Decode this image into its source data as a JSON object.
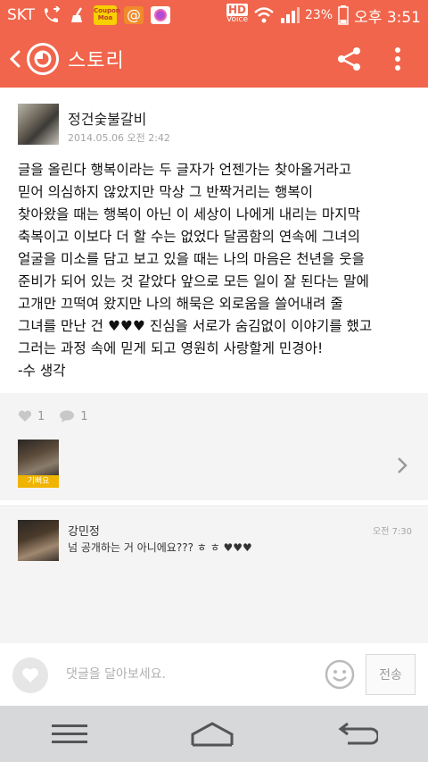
{
  "status_bar": {
    "carrier": "SKT",
    "coupon_line1": "Coupon",
    "coupon_line2": "Moa",
    "hd_voice_top": "HD",
    "hd_voice_bottom": "Voice",
    "battery": "23%",
    "time": "오후 3:51"
  },
  "app_bar": {
    "title": "스토리",
    "back_icon": "chevron-left-icon",
    "logo_icon": "kakaostory-logo-icon",
    "share_icon": "share-icon",
    "more_icon": "more-vertical-icon",
    "color": "#f0654b"
  },
  "post": {
    "author": "정건숯불갈비",
    "date": "2014.05.06 오전 2:42",
    "body": "글을 올린다 행복이라는 두 글자가 언젠가는 찾아올거라고\n믿어 의심하지 않았지만 막상 그 반짝거리는 행복이\n찾아왔을 때는 행복이 아닌 이 세상이 나에게 내리는 마지막\n축복이고 이보다 더 할 수는 없었다 달콤함의 연속에 그녀의\n얼굴을 미소를 담고 보고 있을 때는 나의 마음은 천년을 웃을\n준비가 되어 있는 것 같았다 앞으로 모든 일이 잘 된다는 말에\n고개만 끄떡여 왔지만 나의 해묵은 외로움을 쓸어내려 줄\n그녀를 만난 건 ♥♥♥ 진심을 서로가 숨김없이 이야기를 했고\n그러는 과정 속에 믿게 되고 영원히 사랑할게 민경아!\n-수 생각"
  },
  "reactions": {
    "like_count": "1",
    "comment_count": "1"
  },
  "likers": {
    "badge": "기뻐요"
  },
  "comments": [
    {
      "name": "강민정",
      "time": "오전 7:30",
      "text": "넘 공개하는 거 아니에요??? ㅎ ㅎ ♥♥♥"
    }
  ],
  "input_bar": {
    "placeholder": "댓글을 달아보세요.",
    "send_label": "전송"
  },
  "nav_bar": {
    "menu_icon": "menu-icon",
    "home_icon": "home-icon",
    "back_icon": "back-arrow-icon"
  }
}
